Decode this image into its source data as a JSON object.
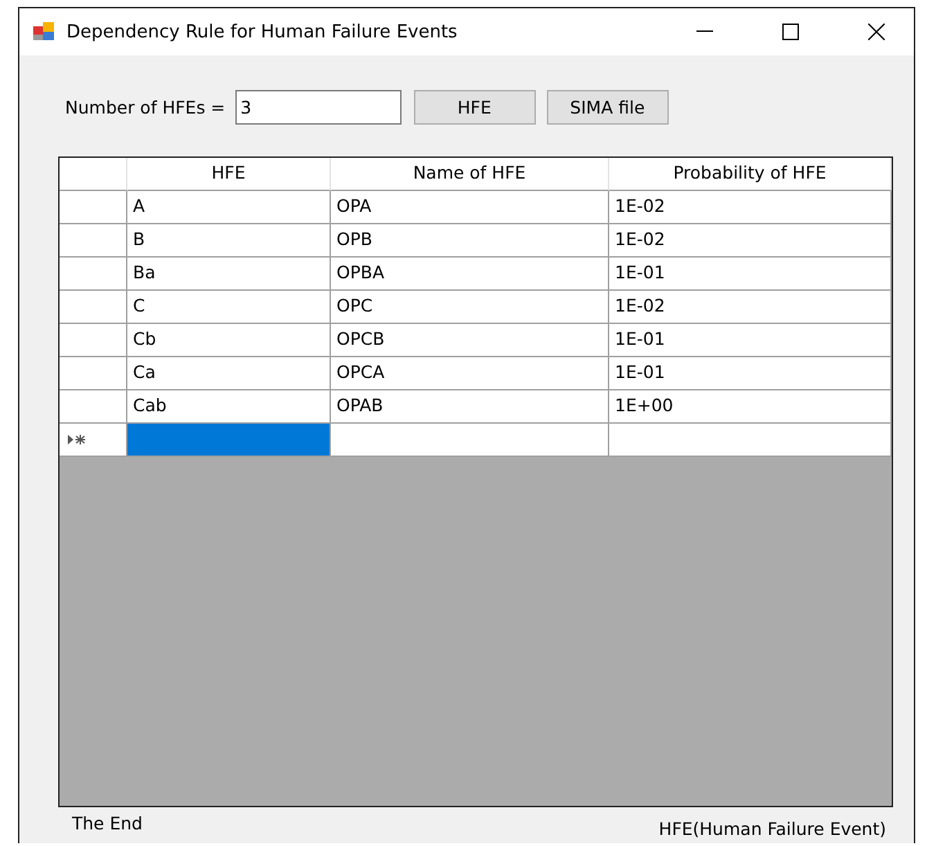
{
  "window": {
    "title": "Dependency Rule for Human Failure Events"
  },
  "form": {
    "count_label": "Number of HFEs =",
    "count_value": "3",
    "buttons": [
      "HFE",
      "SIMA file"
    ]
  },
  "table": {
    "columns": [
      "HFE",
      "Name of HFE",
      "Probability of HFE"
    ],
    "rows": [
      [
        "A",
        "OPA",
        "1E-02"
      ],
      [
        "B",
        "OPB",
        "1E-02"
      ],
      [
        "Ba",
        "OPBA",
        "1E-01"
      ],
      [
        "C",
        "OPC",
        "1E-02"
      ],
      [
        "Cb",
        "OPCB",
        "1E-01"
      ],
      [
        "Ca",
        "OPCA",
        "1E-01"
      ],
      [
        "Cab",
        "OPAB",
        "1E+00"
      ]
    ],
    "new_row": [
      {
        "selected": true
      },
      {
        "selected": false
      },
      {
        "selected": false
      }
    ]
  },
  "status": {
    "left": "The End",
    "right": "HFE(Human Failure Event)"
  }
}
